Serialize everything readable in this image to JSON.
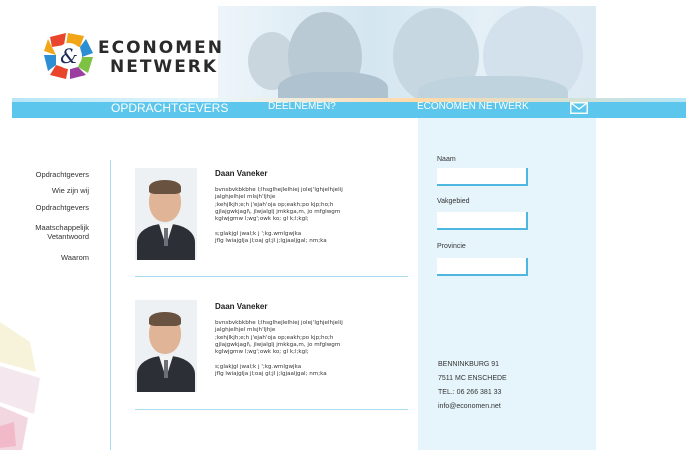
{
  "brand": {
    "line1": "ECONOMEN",
    "line2": "NETWERK",
    "logo_glyph": "&"
  },
  "nav": {
    "items": [
      "OPDRACHTGEVERS",
      "DEELNEMEN?",
      "ECONOMEN NETWERK"
    ],
    "mail_icon": "envelope-icon"
  },
  "sidebar": {
    "items": [
      "Opdrachtgevers",
      "Wie zijn wij",
      "Opdrachtgevers",
      "Maatschappelijk\nVetantwoord",
      "Waarom"
    ]
  },
  "profiles": [
    {
      "name": "Daan Vaneker",
      "bio": "bvnsbvkbkbhe l;lhsglhejlelhiej jolejʼlghjelhjelij\njalghjelhjel mlsjh'ljhje\n;kehjlkjh;e;h j'ejah'oja op;eakh;po kjp;ho;h\ngjlajgwkjagl\\, jlwjalglj jmkkga,m, jo mfglwgm\nkglwjgmw l;wg';owk ko; gl k;l;kgl;\n\ns;glakjgl jwal;k j ';kg.wmlgwjka\njflg lwiajglja jl;oaj gl;jl j;lgjaaljgal; nm;ka"
    },
    {
      "name": "Daan Vaneker",
      "bio": "bvnsbvkbkbhe l;lhsglhejlelhiej jolejʼlghjelhjelij\njalghjelhjel mlsjh'ljhje\n;kehjlkjh;e;h j'ejah'oja op;eakh;po kjp;ho;h\ngjlajgwkjagl\\, jlwjalglj jmkkga,m, jo mfglwgm\nkglwjgmw l;wg';owk ko; gl k;l;kgl;\n\ns;glakjgl jwal;k j ';kg.wmlgwjka\njflg lwiajglja jl;oaj gl;jl j;lgjaaljgal; nm;ka"
    }
  ],
  "form": {
    "fields": [
      {
        "label": "Naam",
        "value": ""
      },
      {
        "label": "Vakgebied",
        "value": ""
      },
      {
        "label": "Provincie",
        "value": ""
      }
    ]
  },
  "contact": {
    "street": "BENNINKBURG 91",
    "city": "7511 MC  ENSCHEDE",
    "phone": "TEL.: 06 266 381 33",
    "email": "info@economen.net"
  },
  "colors": {
    "nav_blue": "#5cc6ec",
    "panel_bg": "#e6f5fc",
    "accent_border": "#4fb6df"
  }
}
